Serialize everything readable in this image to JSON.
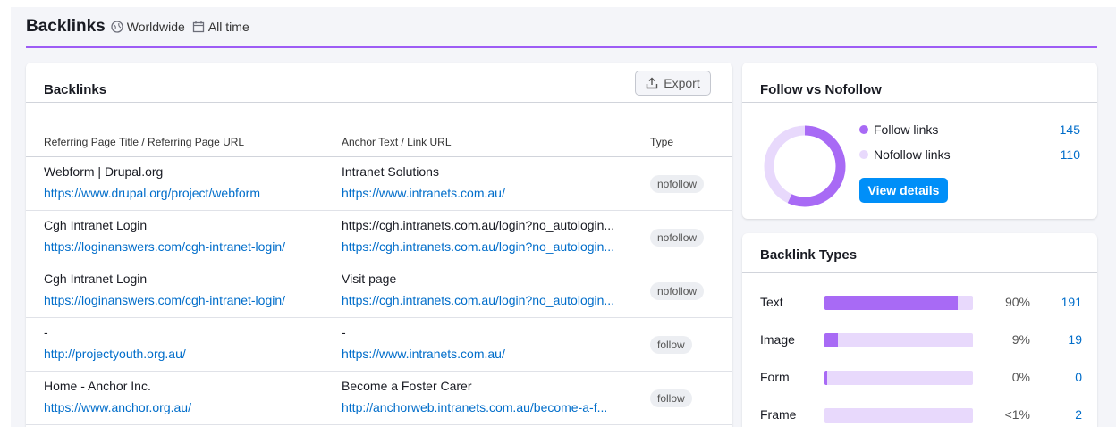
{
  "header": {
    "title": "Backlinks",
    "region": "Worldwide",
    "period": "All time",
    "accent": "#9d5cf5"
  },
  "backlinks": {
    "title": "Backlinks",
    "export_label": "Export",
    "columns": [
      "Referring Page Title / Referring Page URL",
      "Anchor Text / Link URL",
      "Type"
    ],
    "rows": [
      {
        "title": "Webform | Drupal.org",
        "url": "https://www.drupal.org/project/webform",
        "anchor": "Intranet Solutions",
        "link": "https://www.intranets.com.au/",
        "type": "nofollow"
      },
      {
        "title": "Cgh Intranet Login",
        "url": "https://loginanswers.com/cgh-intranet-login/",
        "anchor": "https://cgh.intranets.com.au/login?no_autologin...",
        "link": "https://cgh.intranets.com.au/login?no_autologin...",
        "type": "nofollow"
      },
      {
        "title": "Cgh Intranet Login",
        "url": "https://loginanswers.com/cgh-intranet-login/",
        "anchor": "Visit page",
        "link": "https://cgh.intranets.com.au/login?no_autologin...",
        "type": "nofollow"
      },
      {
        "title": "-",
        "url": "http://projectyouth.org.au/",
        "anchor": "-",
        "link": "https://www.intranets.com.au/",
        "type": "follow"
      },
      {
        "title": "Home - Anchor Inc.",
        "url": "https://www.anchor.org.au/",
        "anchor": "Become a Foster Carer",
        "link": "http://anchorweb.intranets.com.au/become-a-f...",
        "type": "follow"
      }
    ]
  },
  "follow": {
    "title": "Follow vs Nofollow",
    "follow_label": "Follow links",
    "follow_count": "145",
    "nofollow_label": "Nofollow links",
    "nofollow_count": "110",
    "follow_color": "#a86af5",
    "nofollow_color": "#e8d9fc",
    "button_label": "View details"
  },
  "types": {
    "title": "Backlink Types",
    "items": [
      {
        "label": "Text",
        "pct": "90%",
        "count": "191",
        "share": 0.9
      },
      {
        "label": "Image",
        "pct": "9%",
        "count": "19",
        "share": 0.09
      },
      {
        "label": "Form",
        "pct": "0%",
        "count": "0",
        "share": 0.015
      },
      {
        "label": "Frame",
        "pct": "<1%",
        "count": "2",
        "share": 0.0
      }
    ]
  }
}
